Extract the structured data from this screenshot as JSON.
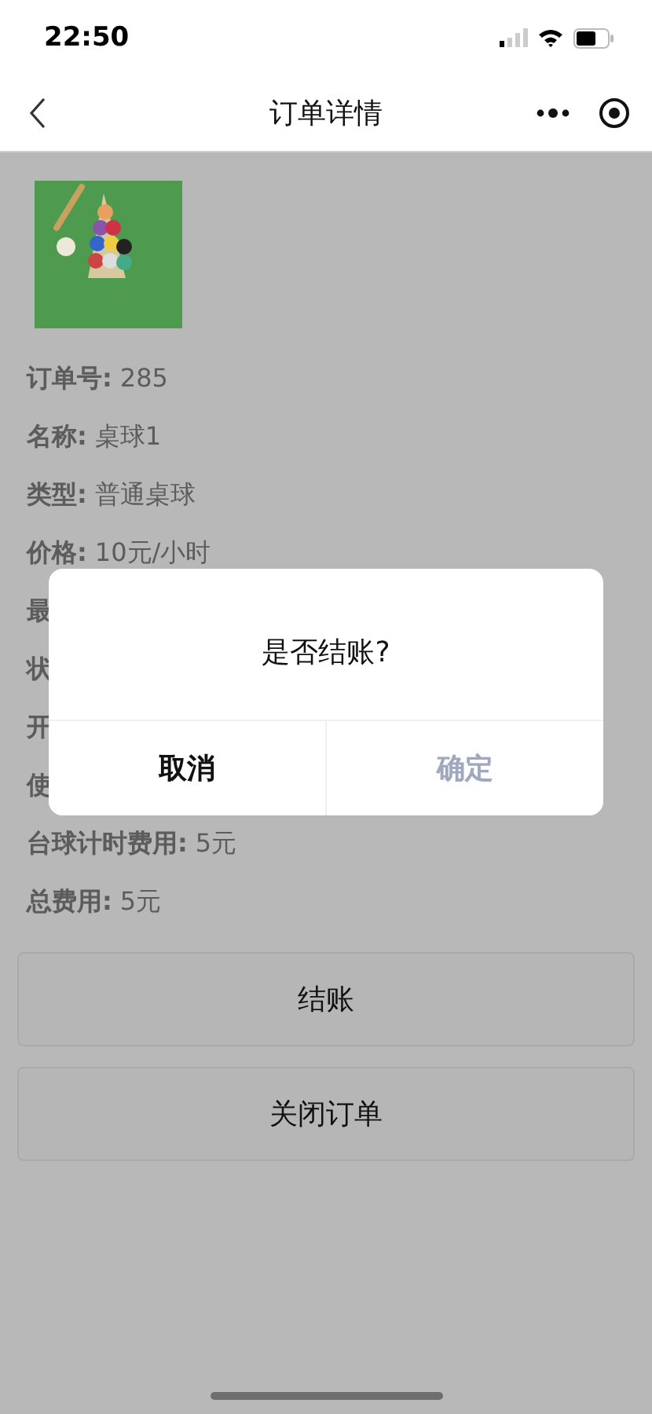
{
  "status_bar": {
    "time": "22:50"
  },
  "nav": {
    "title": "订单详情"
  },
  "order": {
    "fields": [
      {
        "label": "订单号:",
        "value": "285"
      },
      {
        "label": "名称:",
        "value": "桌球1"
      },
      {
        "label": "类型:",
        "value": "普通桌球"
      },
      {
        "label": "价格:",
        "value": "10元/小时"
      },
      {
        "label": "最"
      },
      {
        "label": "状"
      },
      {
        "label": "开"
      },
      {
        "label": "使"
      },
      {
        "label": "台球计时费用:",
        "value": "5元"
      },
      {
        "label": "总费用:",
        "value": "5元"
      }
    ],
    "buttons": [
      "结账",
      "关闭订单"
    ]
  },
  "dialog": {
    "message": "是否结账?",
    "cancel": "取消",
    "confirm": "确定"
  }
}
